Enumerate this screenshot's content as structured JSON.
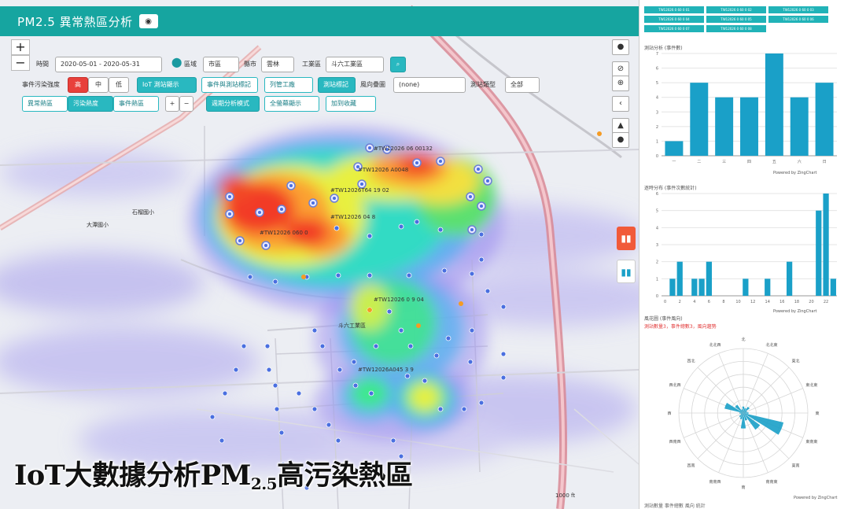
{
  "app": {
    "title": "PM2.5 異常熱區分析",
    "title_button_icon": "eye-icon"
  },
  "map": {
    "zoom_in": "+",
    "zoom_out": "−",
    "period_label": "時間",
    "period_value": "2020-05-01 - 2020-05-31",
    "region_label": "區域",
    "region_value": "市區",
    "district_label": "縣市",
    "district_value": "雲林",
    "industrial_label": "工業區",
    "industrial_value": "斗六工業區",
    "event_label": "事件污染強度",
    "levels": [
      "高",
      "中",
      "低"
    ],
    "iot_button": "IoT 測站顯示",
    "event_map_button": "事件與測站標記",
    "factory_button": "列管工廠",
    "sensor_button": "測站標記",
    "wind_label": "風向疊圖",
    "wind_value": "(none)",
    "pollutant_label": "測站類型",
    "pollutant_value": "全部",
    "mode_tabs": [
      "異常熱區",
      "污染熱度",
      "事件熱區"
    ],
    "analysis_button": "週期分析模式",
    "fullscreen_button": "全螢幕顯示",
    "favorite_button": "加到收藏",
    "side_buttons": [
      "●",
      "⊘",
      "⊕",
      "‹",
      "▲",
      "●"
    ],
    "station_labels": [
      "#TW12026 06 00132",
      "#TW12026 A0048",
      "#TW12026T64 19 02",
      "#TW12026 04 8",
      "#TW12026 060 0",
      "#TW12026 0 9 04",
      "#TW12026A045 3 9"
    ],
    "place_labels": [
      "石榴國小",
      "斗六工業區",
      "大潭國小"
    ],
    "scale_text": "1000 ft"
  },
  "caption": {
    "main": "IoT大數據分析PM",
    "sub": "2.5",
    "tail": "高污染熱區"
  },
  "right_panel": {
    "chips": [
      "TW12026 0 60 0 01",
      "TW12026 0 60 0 02",
      "TW12026 0 60 0 03",
      "TW12026 0 60 0 04",
      "TW12026 0 60 0 05",
      "TW12026 0 60 0 06",
      "TW12026 0 60 0 07",
      "TW12026 0 60 0 08"
    ],
    "chart1_title": "測站分析 (事件數)",
    "chart2_title": "逐時分布 (事件次數統計)",
    "chart3_title": "風花圖 (事件風向)",
    "red_note": "測站數量3，事件總數3，風向趨勢",
    "credit": "Powered by ZingChart",
    "footer": "測站數量 事件總數 風向 統計"
  },
  "chart_data": [
    {
      "type": "bar",
      "title": "",
      "categories": [
        "一",
        "二",
        "三",
        "四",
        "五",
        "六",
        "日"
      ],
      "values": [
        1,
        5,
        4,
        4,
        7,
        4,
        5
      ],
      "ylim": [
        0,
        7
      ],
      "y_ticks": [
        0,
        1,
        2,
        3,
        4,
        5,
        6,
        7
      ],
      "color": "#1aa0c8",
      "grid": true
    },
    {
      "type": "bar",
      "title": "",
      "x": [
        0,
        1,
        2,
        3,
        4,
        5,
        6,
        7,
        8,
        9,
        10,
        11,
        12,
        13,
        14,
        15,
        16,
        17,
        18,
        19,
        20,
        21,
        22,
        23
      ],
      "x_ticks": [
        0,
        2,
        4,
        6,
        8,
        10,
        12,
        14,
        16,
        18,
        20,
        22
      ],
      "values": [
        0,
        1,
        2,
        0,
        1,
        1,
        2,
        0,
        0,
        0,
        0,
        1,
        0,
        0,
        1,
        0,
        0,
        2,
        0,
        0,
        0,
        5,
        6,
        1
      ],
      "ylim": [
        0,
        6
      ],
      "y_ticks": [
        0,
        1,
        2,
        3,
        4,
        5,
        6
      ],
      "color": "#1aa0c8",
      "grid": true
    },
    {
      "type": "rose",
      "title": "",
      "directions": [
        "N",
        "NNE",
        "NE",
        "ENE",
        "E",
        "ESE",
        "SE",
        "SSE",
        "S",
        "SSW",
        "SW",
        "WSW",
        "W",
        "WNW",
        "NW",
        "NNW"
      ],
      "direction_labels": [
        "北",
        "北北東",
        "東北",
        "東北東",
        "東",
        "東南東",
        "東南",
        "南南東",
        "南",
        "南南西",
        "西南",
        "西南西",
        "西",
        "西北西",
        "西北",
        "北北西"
      ],
      "values": [
        0.5,
        0.4,
        0.6,
        0.3,
        0.4,
        3.2,
        1.6,
        0.6,
        1.2,
        0.5,
        0.4,
        0.2,
        0.3,
        1.5,
        0.8,
        0.3
      ],
      "rmax": 5,
      "color": "#1aa0c8"
    }
  ]
}
